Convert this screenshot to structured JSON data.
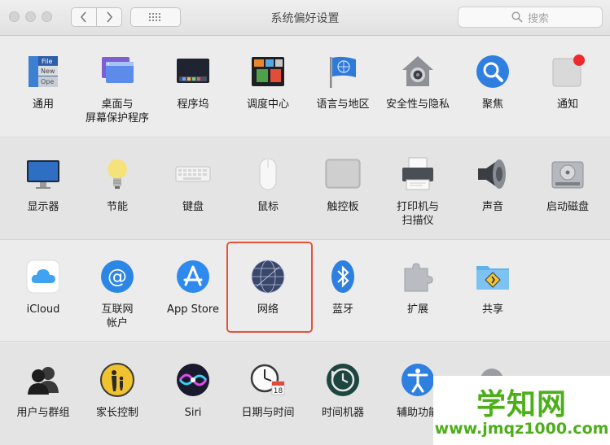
{
  "window": {
    "title": "系统偏好设置"
  },
  "search": {
    "placeholder": "搜索"
  },
  "rows": [
    {
      "items": [
        {
          "label": "通用",
          "icon": "general-icon"
        },
        {
          "label": "桌面与\n屏幕保护程序",
          "icon": "desktop-icon"
        },
        {
          "label": "程序坞",
          "icon": "dock-icon"
        },
        {
          "label": "调度中心",
          "icon": "mission-control-icon"
        },
        {
          "label": "语言与地区",
          "icon": "flag-icon"
        },
        {
          "label": "安全性与隐私",
          "icon": "house-lock-icon"
        },
        {
          "label": "聚焦",
          "icon": "spotlight-icon"
        },
        {
          "label": "通知",
          "icon": "notifications-icon"
        }
      ]
    },
    {
      "items": [
        {
          "label": "显示器",
          "icon": "display-icon"
        },
        {
          "label": "节能",
          "icon": "lightbulb-icon"
        },
        {
          "label": "键盘",
          "icon": "keyboard-icon"
        },
        {
          "label": "鼠标",
          "icon": "mouse-icon"
        },
        {
          "label": "触控板",
          "icon": "trackpad-icon"
        },
        {
          "label": "打印机与\n扫描仪",
          "icon": "printer-icon"
        },
        {
          "label": "声音",
          "icon": "speaker-icon"
        },
        {
          "label": "启动磁盘",
          "icon": "disk-icon"
        }
      ]
    },
    {
      "items": [
        {
          "label": "iCloud",
          "icon": "icloud-icon"
        },
        {
          "label": "互联网\n帐户",
          "icon": "at-icon"
        },
        {
          "label": "App Store",
          "icon": "app-store-icon"
        },
        {
          "label": "网络",
          "icon": "network-globe-icon"
        },
        {
          "label": "蓝牙",
          "icon": "bluetooth-icon"
        },
        {
          "label": "扩展",
          "icon": "puzzle-icon"
        },
        {
          "label": "共享",
          "icon": "sharing-folder-icon"
        }
      ]
    },
    {
      "items": [
        {
          "label": "用户与群组",
          "icon": "users-icon"
        },
        {
          "label": "家长控制",
          "icon": "parental-icon"
        },
        {
          "label": "Siri",
          "icon": "siri-icon"
        },
        {
          "label": "日期与时间",
          "icon": "clock-calendar-icon"
        },
        {
          "label": "时间机器",
          "icon": "time-machine-icon"
        },
        {
          "label": "辅助功能",
          "icon": "accessibility-icon"
        }
      ]
    }
  ],
  "watermark": {
    "top": "学知网",
    "bottom": "www.jmqz1000.com"
  }
}
